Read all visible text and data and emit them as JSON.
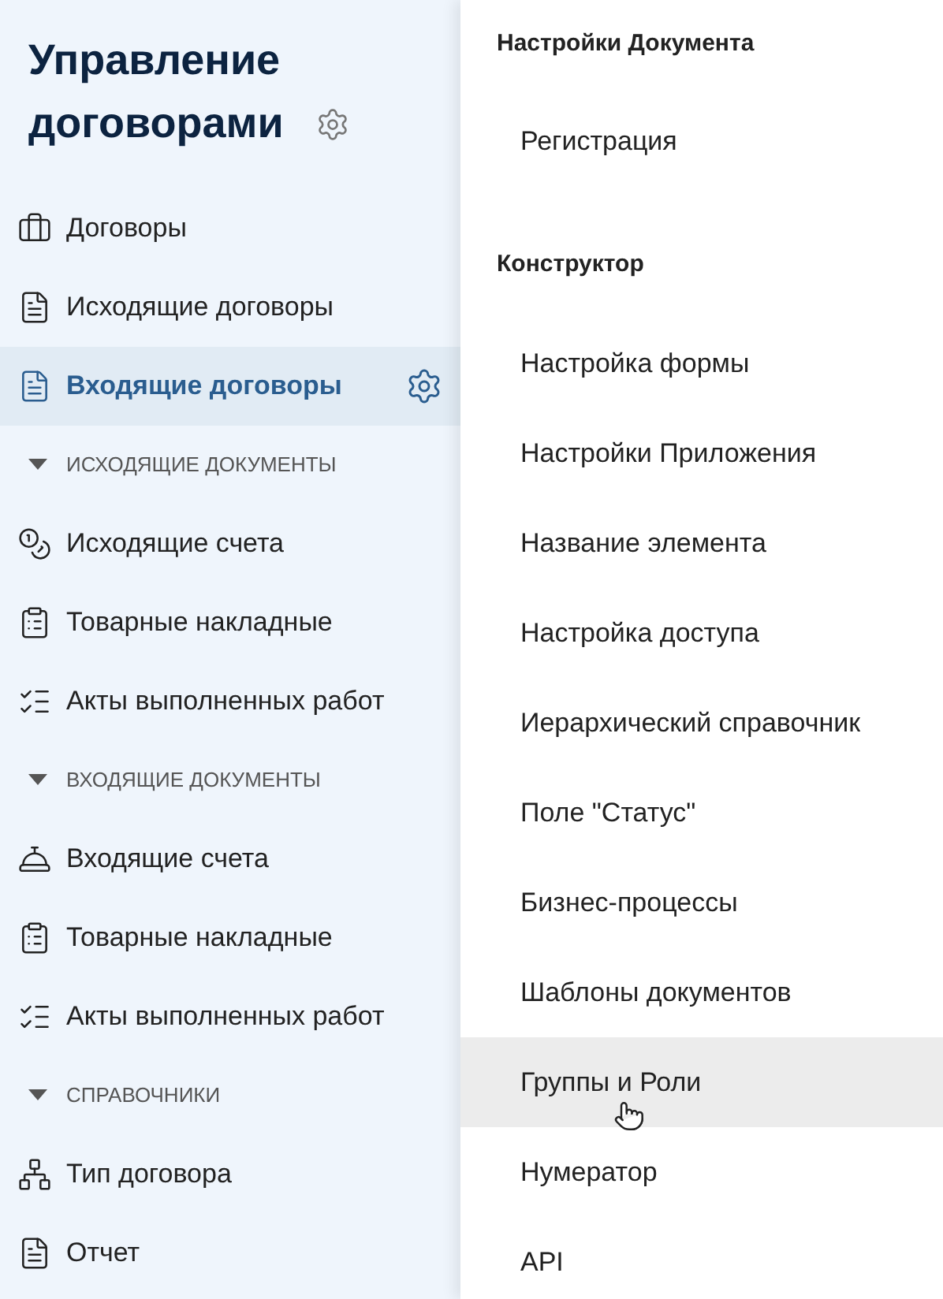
{
  "sidebar": {
    "title": "Управление договорами",
    "items": [
      {
        "kind": "item",
        "label": "Договоры",
        "selected": false
      },
      {
        "kind": "item",
        "label": "Исходящие договоры",
        "selected": false
      },
      {
        "kind": "item",
        "label": "Входящие договоры",
        "selected": true
      },
      {
        "kind": "section",
        "label": "ИСХОДЯЩИЕ ДОКУМЕНТЫ",
        "expanded": true
      },
      {
        "kind": "item",
        "label": "Исходящие счета",
        "selected": false
      },
      {
        "kind": "item",
        "label": "Товарные накладные",
        "selected": false
      },
      {
        "kind": "item",
        "label": "Акты выполненных работ",
        "selected": false
      },
      {
        "kind": "section",
        "label": "ВХОДЯЩИЕ ДОКУМЕНТЫ",
        "expanded": true
      },
      {
        "kind": "item",
        "label": "Входящие счета",
        "selected": false
      },
      {
        "kind": "item",
        "label": "Товарные накладные",
        "selected": false
      },
      {
        "kind": "item",
        "label": "Акты выполненных работ",
        "selected": false
      },
      {
        "kind": "section",
        "label": "СПРАВОЧНИКИ",
        "expanded": true
      },
      {
        "kind": "item",
        "label": "Тип договора",
        "selected": false
      },
      {
        "kind": "item",
        "label": "Отчет",
        "selected": false
      }
    ]
  },
  "menu": {
    "items": [
      {
        "kind": "header",
        "label": "Настройки Документа"
      },
      {
        "kind": "item",
        "label": "Регистрация",
        "hovered": false
      },
      {
        "kind": "header",
        "label": "Конструктор"
      },
      {
        "kind": "item",
        "label": "Настройка формы",
        "hovered": false
      },
      {
        "kind": "item",
        "label": "Настройки Приложения",
        "hovered": false
      },
      {
        "kind": "item",
        "label": "Название элемента",
        "hovered": false
      },
      {
        "kind": "item",
        "label": "Настройка доступа",
        "hovered": false
      },
      {
        "kind": "item",
        "label": "Иерархический справочник",
        "hovered": false
      },
      {
        "kind": "item",
        "label": "Поле \"Статус\"",
        "hovered": false
      },
      {
        "kind": "item",
        "label": "Бизнес-процессы",
        "hovered": false
      },
      {
        "kind": "item",
        "label": "Шаблоны документов",
        "hovered": false
      },
      {
        "kind": "item",
        "label": "Группы и Роли",
        "hovered": true
      },
      {
        "kind": "item",
        "label": "Нумератор",
        "hovered": false
      },
      {
        "kind": "item",
        "label": "API",
        "hovered": false
      }
    ]
  }
}
